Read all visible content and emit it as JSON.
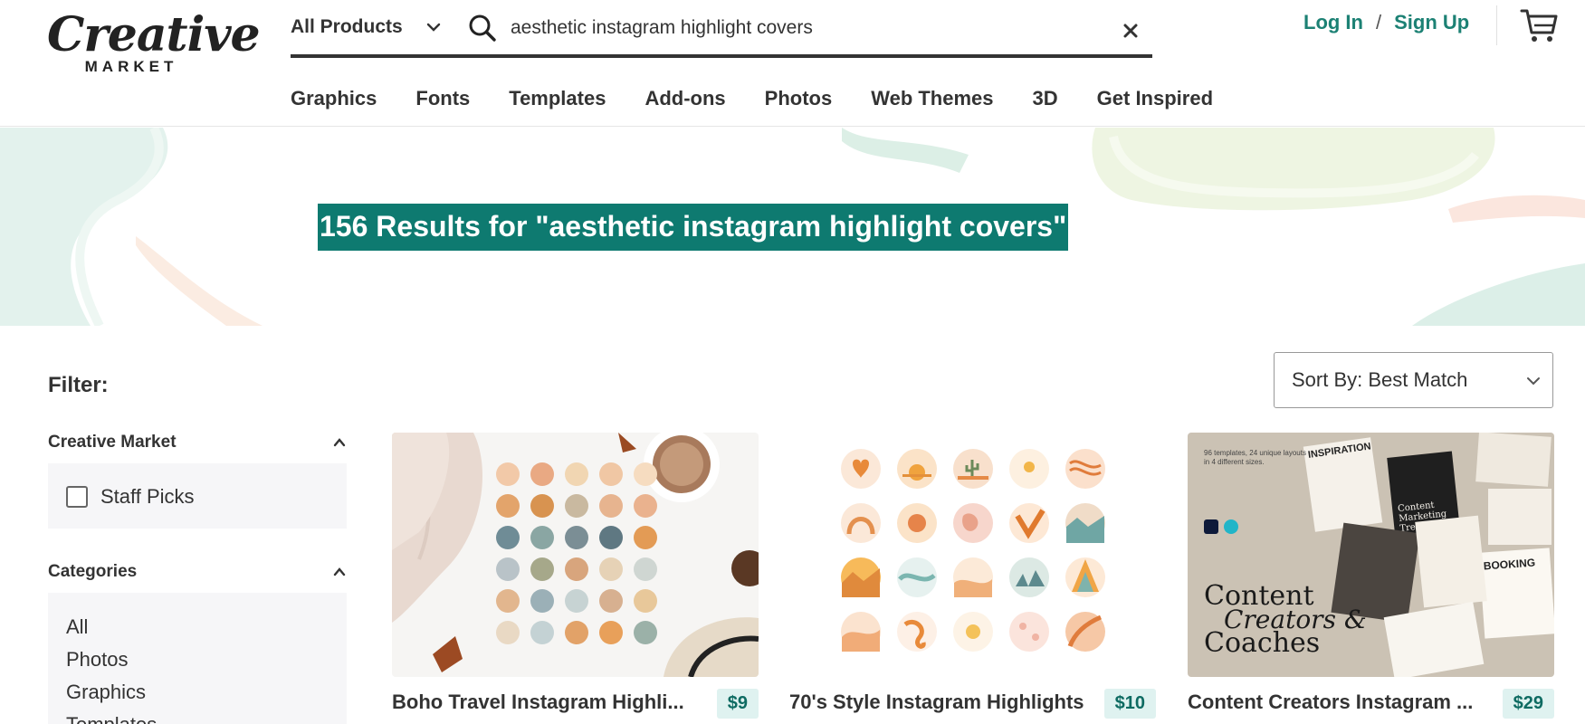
{
  "brand": {
    "logo_main": "Creative",
    "logo_sub": "MARKET"
  },
  "search": {
    "scope": "All Products",
    "query": "aesthetic instagram highlight covers"
  },
  "auth": {
    "login": "Log In",
    "separator": "/",
    "signup": "Sign Up"
  },
  "nav": [
    "Graphics",
    "Fonts",
    "Templates",
    "Add-ons",
    "Photos",
    "Web Themes",
    "3D",
    "Get Inspired"
  ],
  "banner": {
    "title": "156 Results for \"aesthetic instagram highlight covers\""
  },
  "filter": {
    "label": "Filter:",
    "creative_market": {
      "heading": "Creative Market",
      "staff_picks": "Staff Picks"
    },
    "categories": {
      "heading": "Categories",
      "items": [
        "All",
        "Photos",
        "Graphics",
        "Templates"
      ]
    }
  },
  "sort": {
    "label": "Sort By: Best Match"
  },
  "products": [
    {
      "title": "Boho Travel Instagram Highli...",
      "price": "$9"
    },
    {
      "title": "70's Style Instagram Highlights",
      "price": "$10"
    },
    {
      "title": "Content Creators Instagram ...",
      "price": "$29"
    }
  ],
  "thumb3_text": {
    "headline_1": "Content",
    "headline_2": "Creators &",
    "headline_3": "Coaches",
    "inspiration": "INSPIRATION",
    "booking": "BOOKING",
    "content_marketing": "Content Marketing Trends",
    "small_note": "96 templates, 24 unique layouts in 4 different sizes."
  },
  "colors": {
    "accent": "#0e7a70",
    "link": "#1c8174",
    "price_bg": "#dff2f0"
  }
}
